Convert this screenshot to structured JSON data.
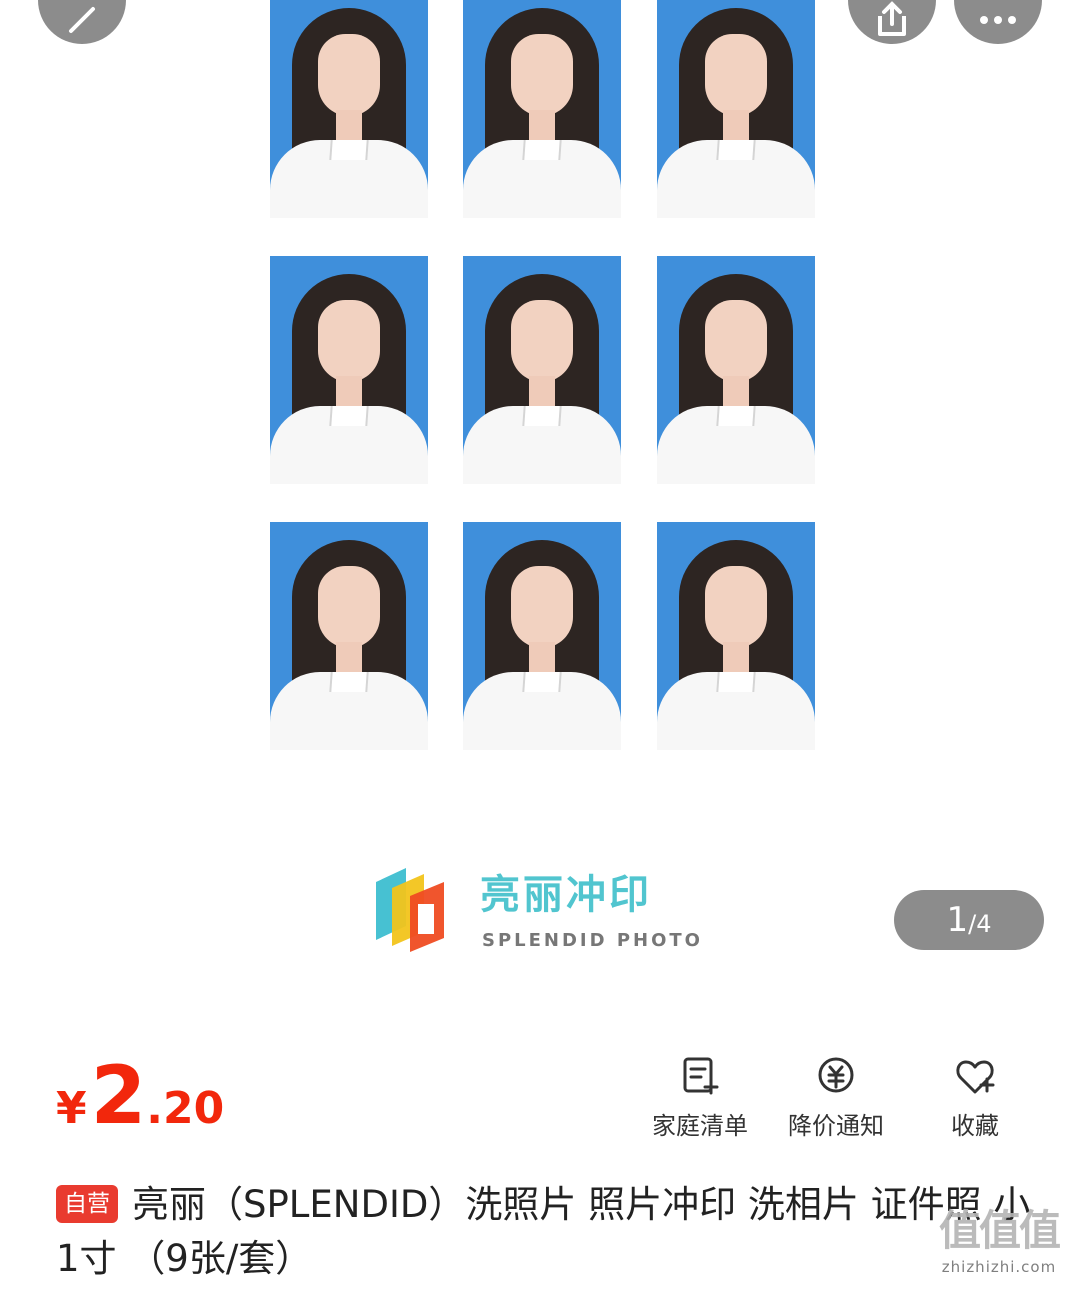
{
  "gallery": {
    "photo_count": 9,
    "brand": {
      "name": "亮丽冲印",
      "subtitle": "SPLENDID PHOTO"
    },
    "counter": {
      "current": "1",
      "total": "/4"
    }
  },
  "overlay_icons": {
    "back": "back-icon",
    "share": "share-icon",
    "more": "more-icon"
  },
  "price": {
    "currency": "¥",
    "integer": "2",
    "decimal": ".20",
    "color": "#f2270c"
  },
  "actions": [
    {
      "label": "家庭清单",
      "icon": "family-list-icon"
    },
    {
      "label": "降价通知",
      "icon": "price-drop-icon"
    },
    {
      "label": "收藏",
      "icon": "heart-icon"
    }
  ],
  "product": {
    "badge": "自营",
    "title": "亮丽（SPLENDID）洗照片 照片冲印 洗相片 证件照 小1寸 （9张/套）"
  },
  "watermark": {
    "icons": "值值值",
    "text": "zhizhizhi.com"
  }
}
